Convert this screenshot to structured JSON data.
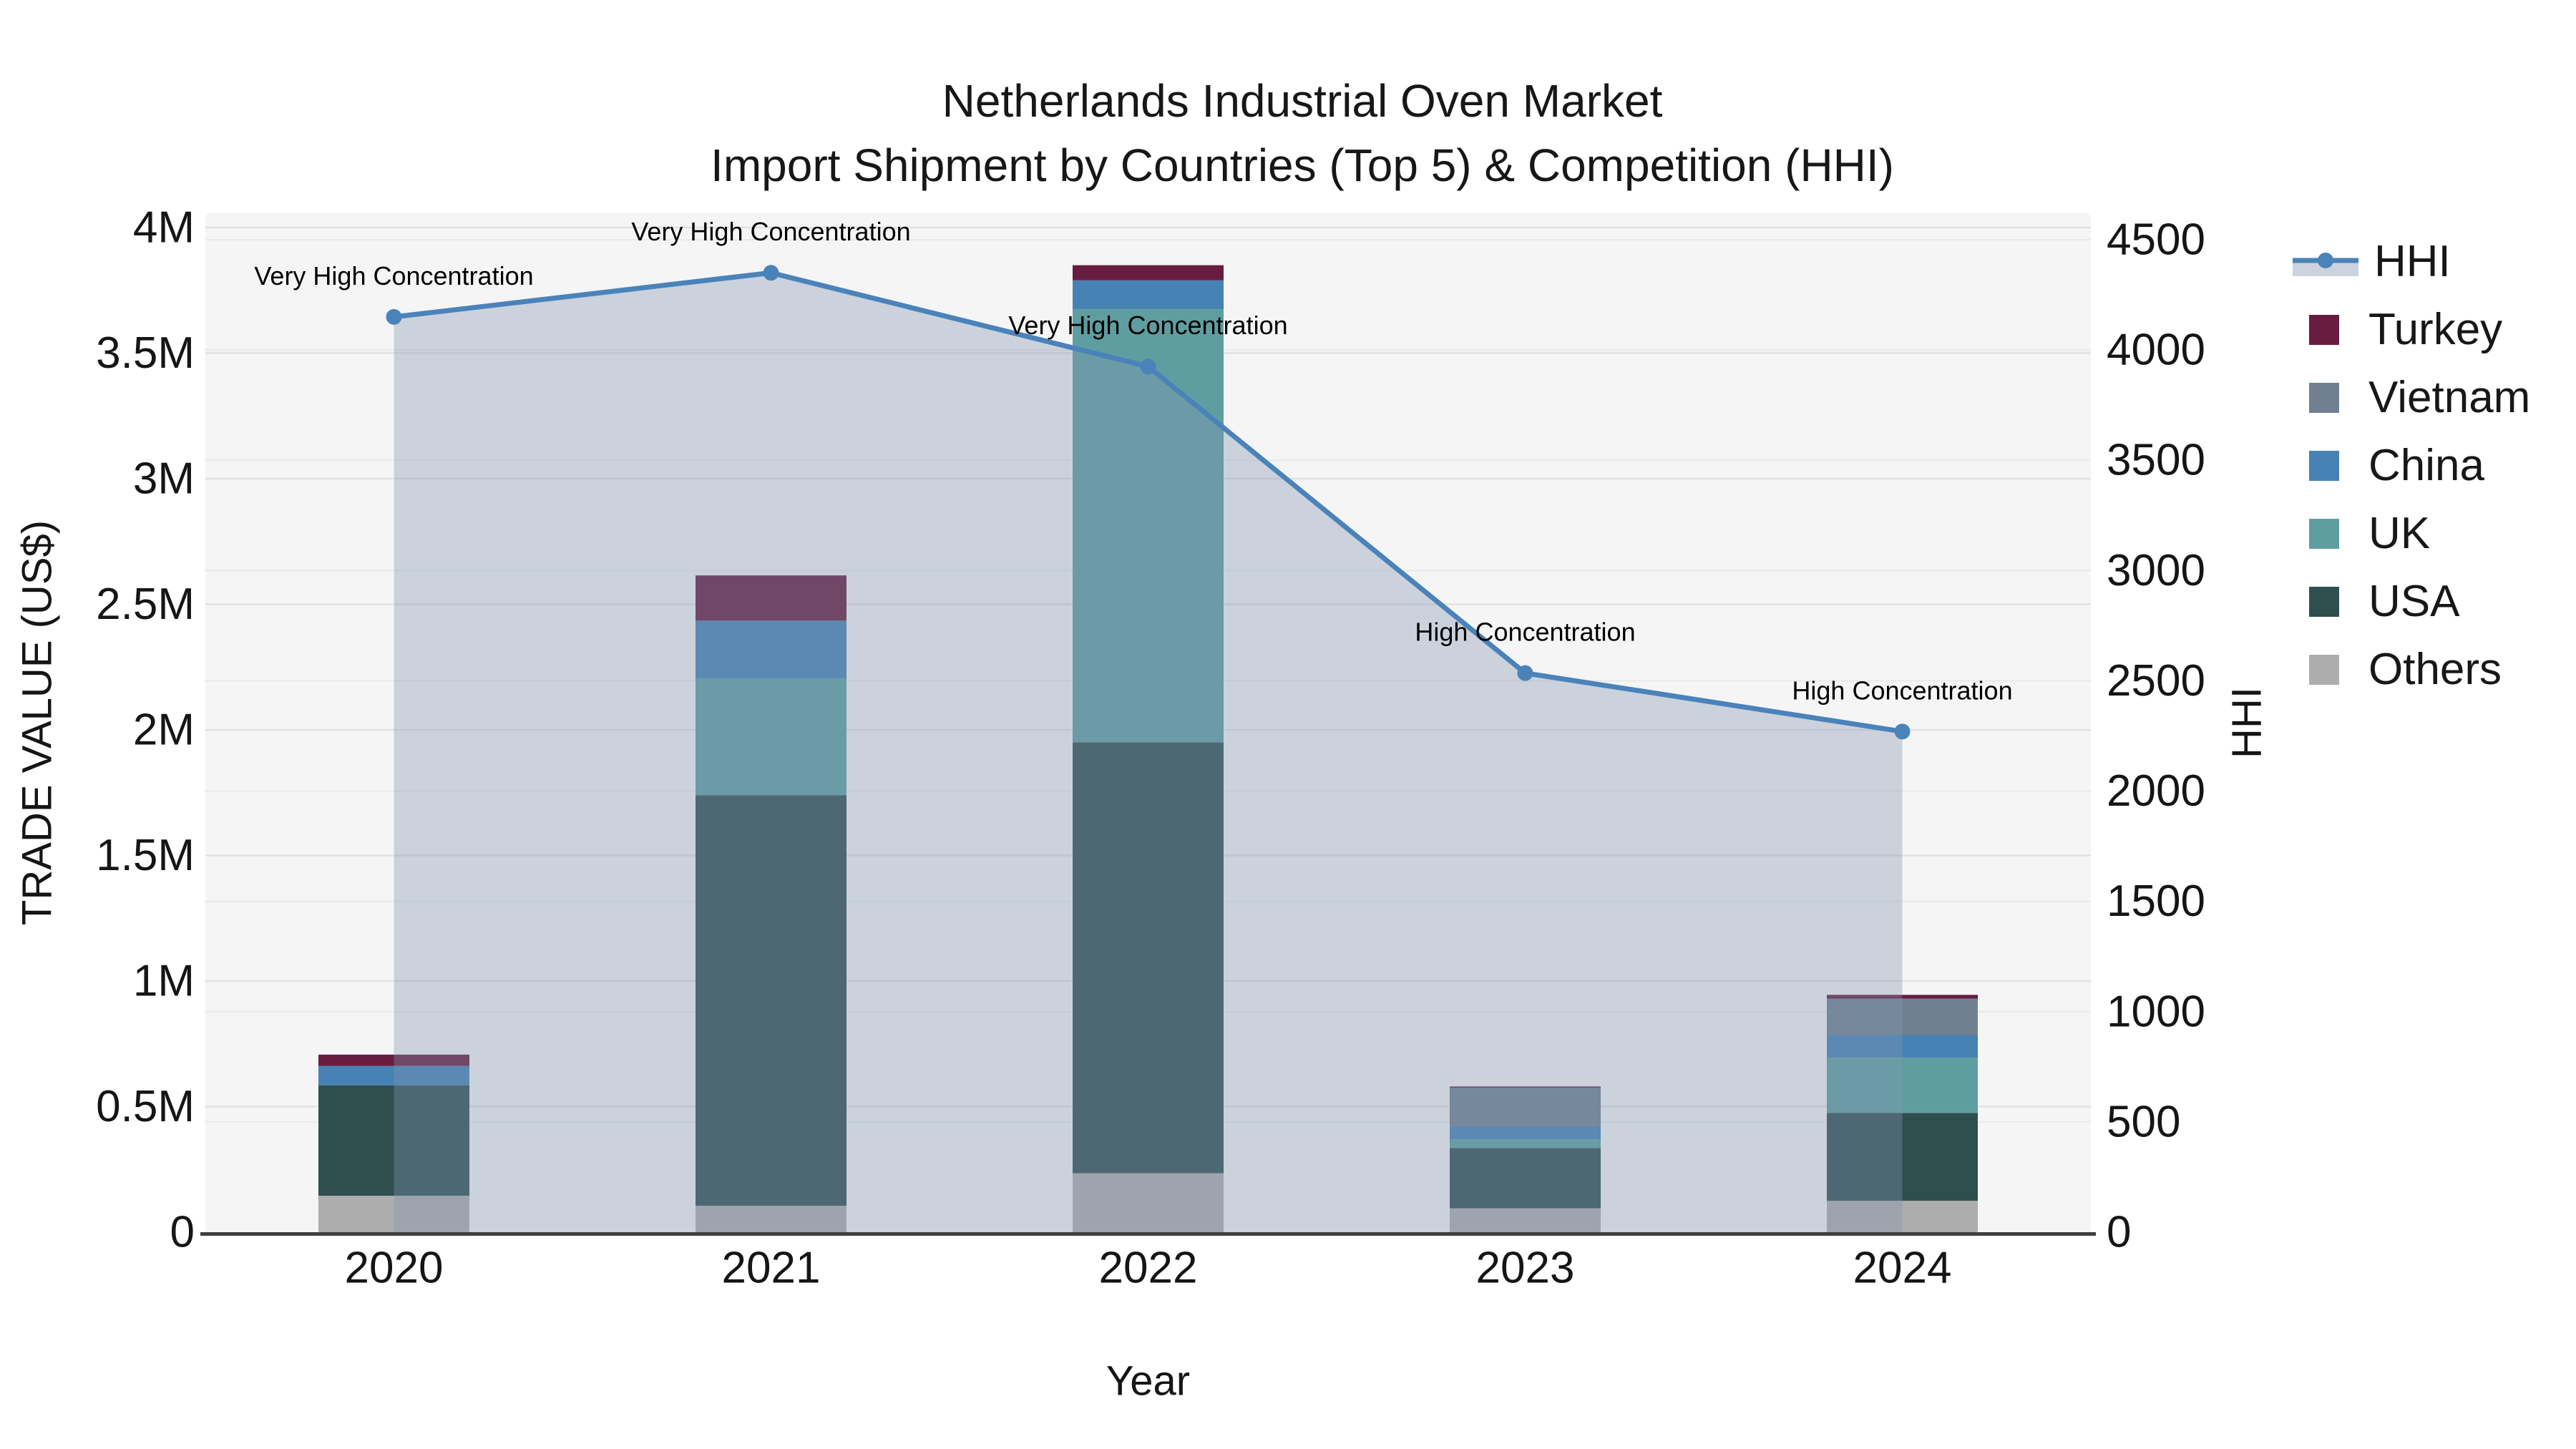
{
  "title": {
    "line1": "Netherlands Industrial Oven Market",
    "line2": "Import Shipment by Countries (Top 5) & Competition (HHI)"
  },
  "axes": {
    "x_label": "Year",
    "y_left_label": "TRADE VALUE (US$)",
    "y_right_label": "HHI",
    "y_left_ticks": [
      "0",
      "0.5M",
      "1M",
      "1.5M",
      "2M",
      "2.5M",
      "3M",
      "3.5M",
      "4M"
    ],
    "y_left_tick_values": [
      0,
      0.5,
      1,
      1.5,
      2,
      2.5,
      3,
      3.5,
      4
    ],
    "y_right_ticks": [
      "0",
      "500",
      "1000",
      "1500",
      "2000",
      "2500",
      "3000",
      "3500",
      "4000",
      "4500"
    ],
    "y_right_tick_values": [
      0,
      500,
      1000,
      1500,
      2000,
      2500,
      3000,
      3500,
      4000,
      4500
    ]
  },
  "style": {
    "plot_bg": "#f5f5f5",
    "grid_left": "#e2e2e2",
    "grid_right": "#e9e9e9",
    "axis_line": "#3f3f3f",
    "text": "#151515",
    "annotation_text": "#000000"
  },
  "legend": [
    {
      "label": "HHI",
      "type": "line",
      "color": "#4a83ba",
      "band_color": "#cdd3de"
    },
    {
      "label": "Turkey",
      "type": "patch",
      "color": "#681c3f"
    },
    {
      "label": "Vietnam",
      "type": "patch",
      "color": "#708090"
    },
    {
      "label": "China",
      "type": "patch",
      "color": "#4682b4"
    },
    {
      "label": "UK",
      "type": "patch",
      "color": "#5f9ea0"
    },
    {
      "label": "USA",
      "type": "patch",
      "color": "#2f4f4f"
    },
    {
      "label": "Others",
      "type": "patch",
      "color": "#adadad"
    }
  ],
  "chart_data": {
    "type": "combo-stacked-bar-line",
    "categories": [
      "2020",
      "2021",
      "2022",
      "2023",
      "2024"
    ],
    "bar_units": "millions USD",
    "bar_series": [
      {
        "name": "Others",
        "color": "#adadad",
        "values": [
          0.145,
          0.105,
          0.235,
          0.095,
          0.125
        ]
      },
      {
        "name": "USA",
        "color": "#2f4f4f",
        "values": [
          0.44,
          1.635,
          1.715,
          0.24,
          0.35
        ]
      },
      {
        "name": "UK",
        "color": "#5f9ea0",
        "values": [
          0,
          0.465,
          1.725,
          0.035,
          0.22
        ]
      },
      {
        "name": "China",
        "color": "#4682b4",
        "values": [
          0.077,
          0.23,
          0.115,
          0.05,
          0.09
        ]
      },
      {
        "name": "Vietnam",
        "color": "#708090",
        "values": [
          0,
          0,
          0,
          0.155,
          0.145
        ]
      },
      {
        "name": "Turkey",
        "color": "#681c3f",
        "values": [
          0.045,
          0.18,
          0.06,
          0.005,
          0.015
        ]
      }
    ],
    "line_series": {
      "name": "HHI",
      "color": "#4a83ba",
      "area_color": "rgba(130,150,178,0.36)",
      "values": [
        4150,
        4350,
        3925,
        2535,
        2270
      ]
    },
    "annotations": [
      "Very High Concentration",
      "Very High Concentration",
      "Very High Concentration",
      "High Concentration",
      "High Concentration"
    ],
    "xlabel": "Year",
    "ylabel_left": "TRADE VALUE (US$)",
    "ylabel_right": "HHI",
    "ylim_left": [
      0,
      4.05
    ],
    "ylim_right": [
      0,
      4613
    ],
    "grid": true,
    "legend_position": "right"
  }
}
